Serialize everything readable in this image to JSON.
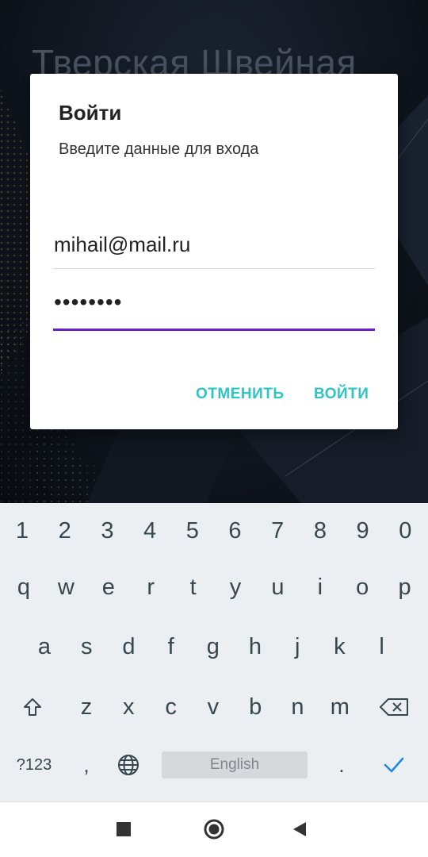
{
  "background": {
    "title": "Тверская Швейная"
  },
  "dialog": {
    "title": "Войти",
    "message": "Введите данные для входа",
    "email": {
      "value": "mihail@mail.ru"
    },
    "password": {
      "value": "••••••••"
    },
    "cancel_label": "ОТМЕНИТЬ",
    "login_label": "ВОЙТИ"
  },
  "keyboard": {
    "number_row": [
      "1",
      "2",
      "3",
      "4",
      "5",
      "6",
      "7",
      "8",
      "9",
      "0"
    ],
    "row1": [
      "q",
      "w",
      "e",
      "r",
      "t",
      "y",
      "u",
      "i",
      "o",
      "p"
    ],
    "row2": [
      "a",
      "s",
      "d",
      "f",
      "g",
      "h",
      "j",
      "k",
      "l"
    ],
    "row3": [
      "z",
      "x",
      "c",
      "v",
      "b",
      "n",
      "m"
    ],
    "symbols_label": "?123",
    "comma_label": ",",
    "space_label": "English",
    "period_label": ".",
    "icons": [
      "shift-icon",
      "backspace-icon",
      "globe-icon",
      "check-icon"
    ]
  },
  "navbar": {
    "icons": [
      "recents-icon",
      "home-icon",
      "back-icon"
    ]
  },
  "colors": {
    "accent": "#6a1fd0",
    "button_text": "#2ec4c4",
    "keyboard_bg": "#eceff1",
    "check": "#1e88e5"
  }
}
